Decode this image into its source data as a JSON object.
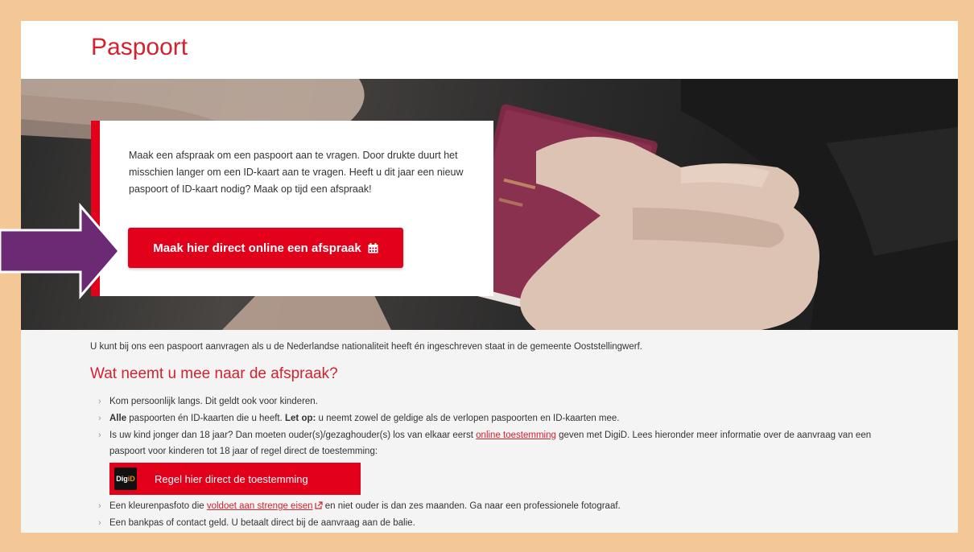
{
  "page": {
    "title": "Paspoort"
  },
  "notice": {
    "text": "Maak een afspraak om een paspoort aan te vragen. Door drukte duurt het misschien langer om een ID-kaart aan te vragen. Heeft u dit jaar een nieuw paspoort of ID-kaart nodig? Maak op tijd een afspraak!",
    "button_label": "Maak hier direct online een afspraak",
    "button_icon": "calendar-icon"
  },
  "content": {
    "intro": "U kunt bij ons een paspoort aanvragen als u de Nederlandse nationaliteit heeft én ingeschreven staat in de gemeente Ooststellingwerf.",
    "heading": "Wat neemt u mee naar de afspraak?",
    "bullets": {
      "b1": "Kom persoonlijk langs. Dit geldt ook voor kinderen.",
      "b2_bold1": "Alle",
      "b2_mid": " paspoorten én ID-kaarten die u heeft. ",
      "b2_bold2": "Let op:",
      "b2_end": " u neemt zowel de geldige als de verlopen paspoorten en ID-kaarten mee.",
      "b3_start": "Is uw kind jonger dan 18 jaar? Dan moeten ouder(s)/gezaghouder(s) los van elkaar eerst ",
      "b3_link": "online toestemming",
      "b3_end": " geven met DigiD. Lees hieronder meer informatie over de aanvraag van een paspoort voor kinderen tot 18 jaar of regel direct de toestemming:",
      "digid_logo_a": "Dig",
      "digid_logo_b": "iD",
      "digid_button_label": "Regel hier direct de toestemming",
      "b4_start": "Een kleurenpasfoto die ",
      "b4_link": "voldoet aan strenge eisen",
      "b4_end": " en niet ouder is dan zes maanden. Ga naar een professionele fotograaf.",
      "b5": "Een bankpas of contact geld. U betaalt direct bij de aanvraag aan de balie."
    }
  },
  "annotation": {
    "arrow_color": "#6b2a73"
  },
  "colors": {
    "brand_red": "#e2001a",
    "heading_red": "#d3222f",
    "frame_border": "#f3c796",
    "passport": "#7a2a45"
  }
}
